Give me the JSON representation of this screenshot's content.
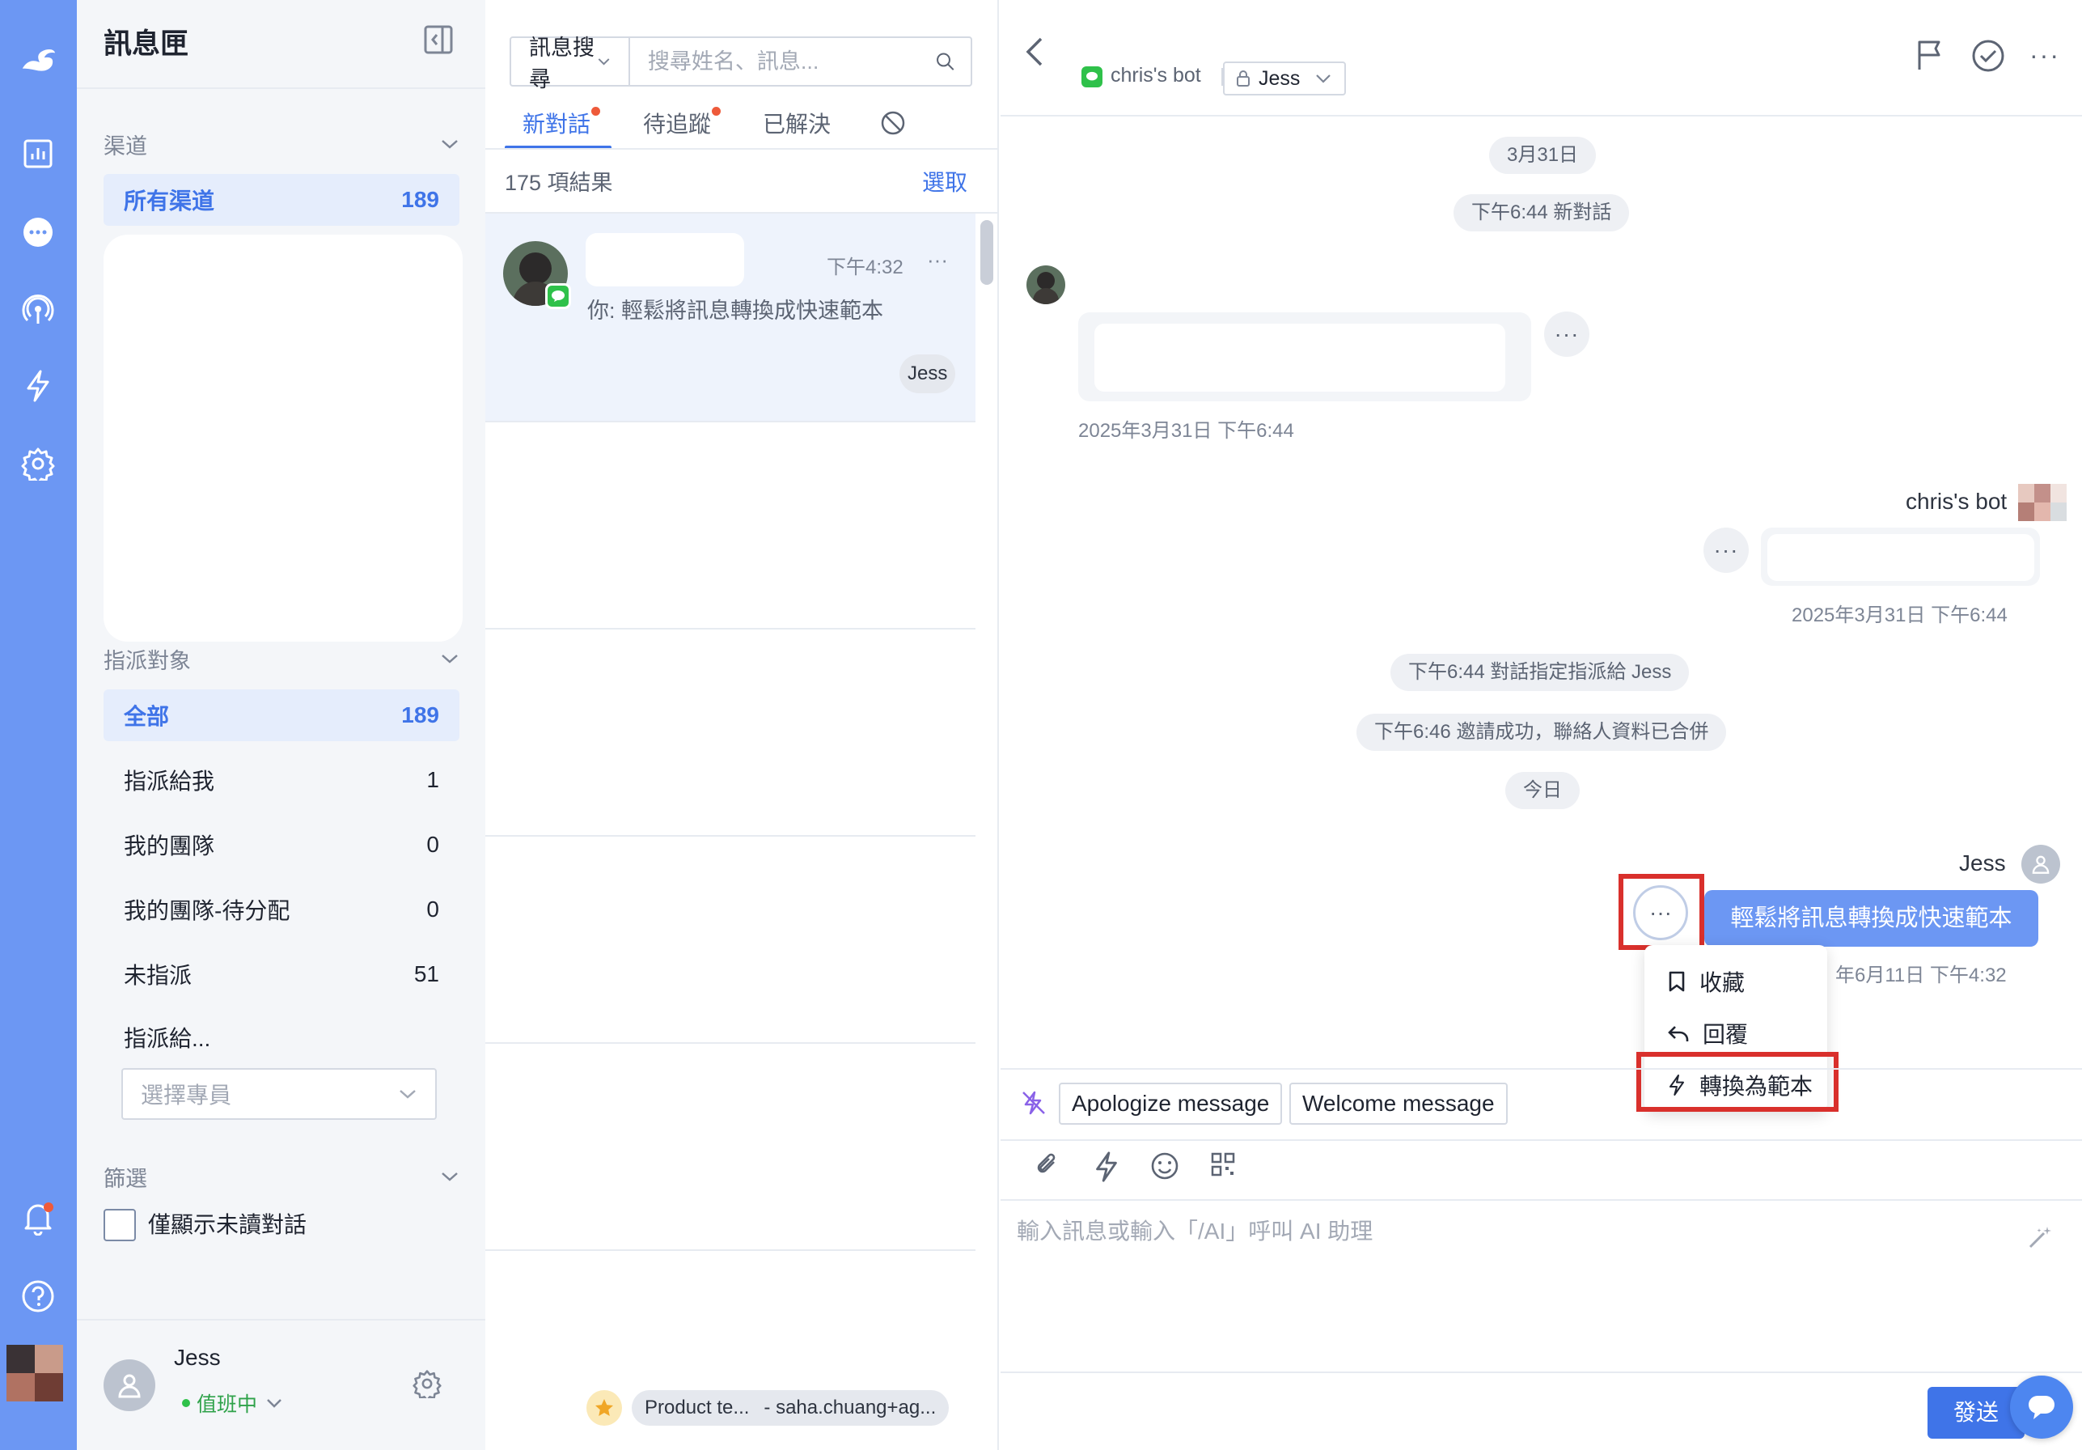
{
  "rail": {
    "icons": [
      "logo-icon",
      "report-icon",
      "chat-icon",
      "broadcast-icon",
      "automation-icon",
      "settings-icon",
      "bell-icon",
      "help-icon"
    ],
    "accent": "#6c97f3"
  },
  "sidebar": {
    "title": "訊息匣",
    "channels": {
      "heading": "渠道",
      "all_label": "所有渠道",
      "all_count": "189"
    },
    "assignees": {
      "heading": "指派對象",
      "items": [
        {
          "label": "全部",
          "count": "189"
        },
        {
          "label": "指派給我",
          "count": "1"
        },
        {
          "label": "我的團隊",
          "count": "0"
        },
        {
          "label": "我的團隊-待分配",
          "count": "0"
        },
        {
          "label": "未指派",
          "count": "51"
        }
      ],
      "assign_to_label": "指派給...",
      "member_select_placeholder": "選擇專員"
    },
    "filter": {
      "heading": "篩選",
      "unread_only_label": "僅顯示未讀對話"
    },
    "user": {
      "name": "Jess",
      "status": "值班中"
    }
  },
  "list": {
    "search_type": "訊息搜尋",
    "search_placeholder": "搜尋姓名、訊息...",
    "tabs": [
      {
        "label": "新對話",
        "dot": true
      },
      {
        "label": "待追蹤",
        "dot": true
      },
      {
        "label": "已解決",
        "dot": false
      }
    ],
    "result_count": "175 項結果",
    "select_label": "選取",
    "conversation": {
      "time": "下午4:32",
      "preview": "你: 輕鬆將訊息轉換成快速範本",
      "assignee_badge": "Jess"
    },
    "tagbar": {
      "tag1": "Product te...",
      "tag2": "- saha.chuang+ag..."
    }
  },
  "chat": {
    "header": {
      "bot_name": "chris's bot",
      "assignee": "Jess"
    },
    "date_pill": "3月31日",
    "system_new": "下午6:44 新對話",
    "incoming_timestamp": "2025年3月31日 下午6:44",
    "bot_sender": "chris's bot",
    "bot_timestamp": "2025年3月31日 下午6:44",
    "system_assigned": "下午6:44 對話指定指派給  Jess",
    "system_invite": "下午6:46 邀請成功，聯絡人資料已合併",
    "today_pill": "今日",
    "out_sender": "Jess",
    "out_message": "輕鬆將訊息轉換成快速範本",
    "out_timestamp_visible": "年6月11日 下午4:32",
    "context_menu": {
      "save": "收藏",
      "reply": "回覆",
      "convert": "轉換為範本"
    },
    "quick_replies": [
      "Apologize message",
      "Welcome message"
    ],
    "composer_placeholder": "輸入訊息或輸入「/AI」呼叫 AI 助理",
    "send_label": "發送"
  },
  "colors": {
    "primary": "#3f74e8",
    "highlight_red": "#d9302c",
    "line_green": "#2fc14a"
  }
}
